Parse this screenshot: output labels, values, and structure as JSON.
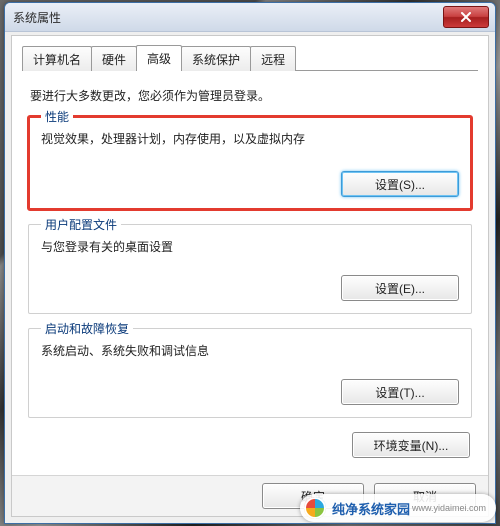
{
  "window": {
    "title": "系统属性"
  },
  "tabs": {
    "computer_name": "计算机名",
    "hardware": "硬件",
    "advanced": "高级",
    "system_protection": "系统保护",
    "remote": "远程"
  },
  "intro": "要进行大多数更改，您必须作为管理员登录。",
  "perf": {
    "title": "性能",
    "desc": "视觉效果，处理器计划，内存使用，以及虚拟内存",
    "button": "设置(S)..."
  },
  "profile": {
    "title": "用户配置文件",
    "desc": "与您登录有关的桌面设置",
    "button": "设置(E)..."
  },
  "startup": {
    "title": "启动和故障恢复",
    "desc": "系统启动、系统失败和调试信息",
    "button": "设置(T)..."
  },
  "env_button": "环境变量(N)...",
  "footer": {
    "ok": "确定",
    "cancel": "取消"
  },
  "watermark": {
    "brand": "纯净系统家园",
    "url": "www.yidaimei.com"
  }
}
